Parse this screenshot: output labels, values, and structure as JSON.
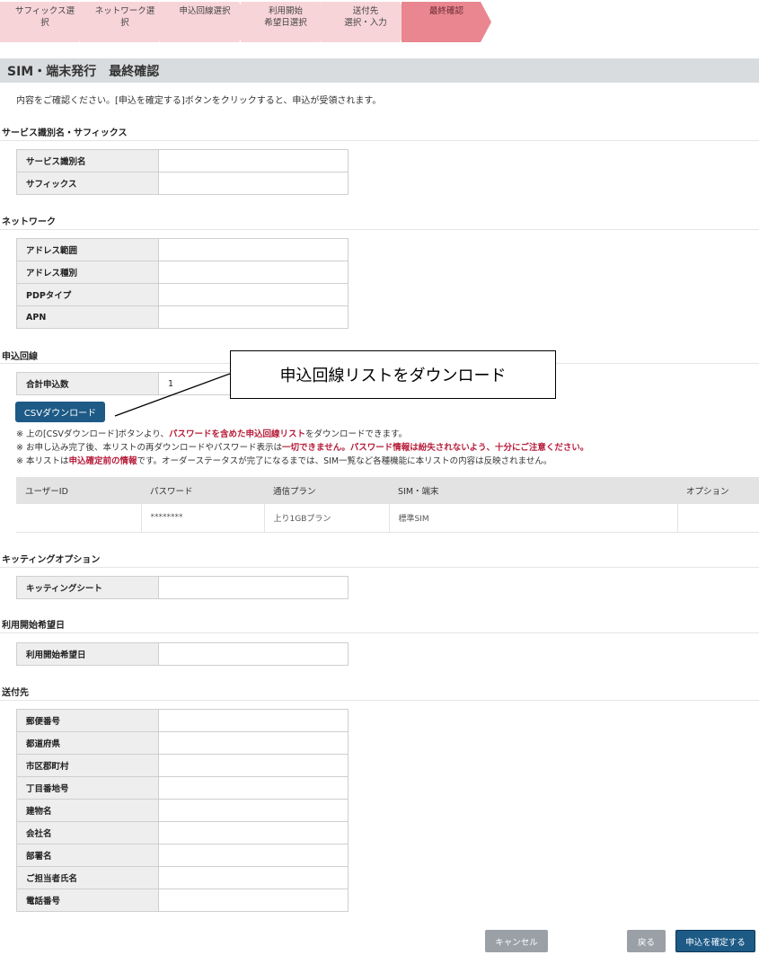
{
  "stepper": {
    "steps": [
      {
        "label": "サフィックス選\n択"
      },
      {
        "label": "ネットワーク選\n択"
      },
      {
        "label": "申込回線選択"
      },
      {
        "label": "利用開始\n希望日選択"
      },
      {
        "label": "送付先\n選択・入力"
      },
      {
        "label": "最終確認"
      }
    ],
    "active_index": 5
  },
  "page": {
    "title": "SIM・端末発行　最終確認",
    "intro": "内容をご確認ください。[申込を確定する]ボタンをクリックすると、申込が受領されます。"
  },
  "service": {
    "heading": "サービス識別名・サフィックス",
    "rows": [
      {
        "label": "サービス識別名",
        "value": ""
      },
      {
        "label": "サフィックス",
        "value": ""
      }
    ]
  },
  "network": {
    "heading": "ネットワーク",
    "rows": [
      {
        "label": "アドレス範囲",
        "value": ""
      },
      {
        "label": "アドレス種別",
        "value": ""
      },
      {
        "label": "PDPタイプ",
        "value": ""
      },
      {
        "label": "APN",
        "value": ""
      }
    ]
  },
  "lines": {
    "heading": "申込回線",
    "total_label": "合計申込数",
    "total_value": "1",
    "csv_button": "CSVダウンロード",
    "callout": "申込回線リストをダウンロード",
    "note1": {
      "a": "※ 上の[CSVダウンロード]ボタンより、",
      "b": "パスワードを含めた申込回線リスト",
      "c": "をダウンロードできます。"
    },
    "note2": {
      "a": "※ お申し込み完了後、本リストの再ダウンロードやパスワード表示は",
      "b": "一切できません。パスワード情報は紛失されないよう、十分にご注意ください。"
    },
    "note3": {
      "a": "※ 本リストは",
      "b": "申込確定前の情報",
      "c": "です。オーダーステータスが完了になるまでは、SIM一覧など各種機能に本リストの内容は反映されません。"
    },
    "columns": [
      "ユーザーID",
      "パスワード",
      "通信プラン",
      "SIM・端末",
      "オプション"
    ],
    "row": {
      "user_id": "",
      "password": "********",
      "plan": "上り1GBプラン",
      "sim": "標準SIM",
      "option": ""
    }
  },
  "kitting": {
    "heading": "キッティングオプション",
    "rows": [
      {
        "label": "キッティングシート",
        "value": ""
      }
    ]
  },
  "start": {
    "heading": "利用開始希望日",
    "rows": [
      {
        "label": "利用開始希望日",
        "value": ""
      }
    ]
  },
  "shipping": {
    "heading": "送付先",
    "rows": [
      {
        "label": "郵便番号",
        "value": ""
      },
      {
        "label": "都道府県",
        "value": ""
      },
      {
        "label": "市区郡町村",
        "value": ""
      },
      {
        "label": "丁目番地号",
        "value": ""
      },
      {
        "label": "建物名",
        "value": ""
      },
      {
        "label": "会社名",
        "value": ""
      },
      {
        "label": "部署名",
        "value": ""
      },
      {
        "label": "ご担当者氏名",
        "value": ""
      },
      {
        "label": "電話番号",
        "value": ""
      }
    ]
  },
  "footer": {
    "cancel": "キャンセル",
    "back": "戻る",
    "confirm": "申込を確定する"
  },
  "colors": {
    "step": "#f7d4d8",
    "step_active": "#e98690",
    "primary": "#1d5a86",
    "warning": "#b71c3a"
  }
}
